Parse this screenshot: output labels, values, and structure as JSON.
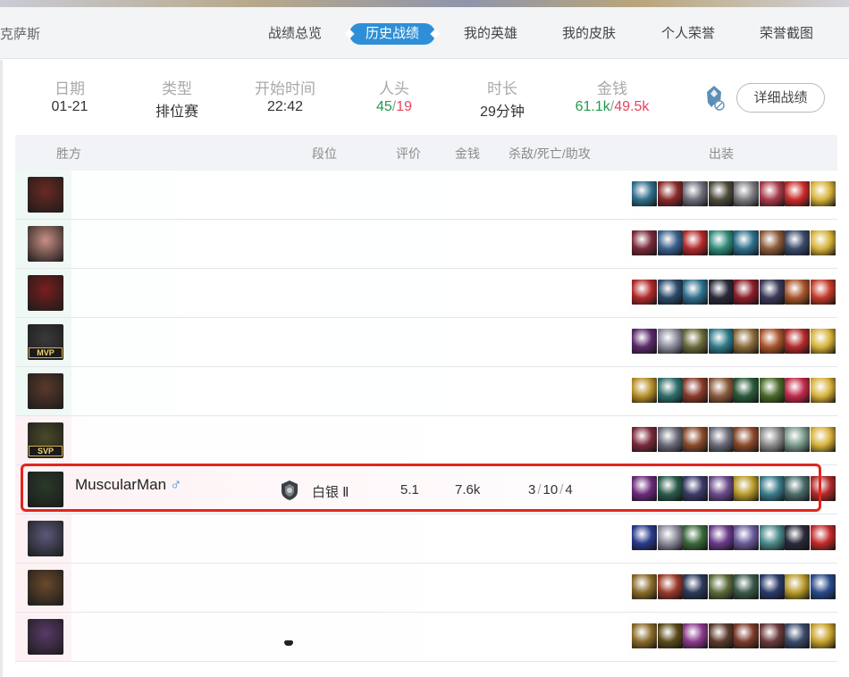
{
  "nav": {
    "player_name": "克萨斯",
    "tabs": [
      "战绩总览",
      "历史战绩",
      "我的英雄",
      "我的皮肤",
      "个人荣誉",
      "荣誉截图"
    ],
    "active_tab": "历史战绩"
  },
  "summary": {
    "date_label": "日期",
    "date": "01-21",
    "type_label": "类型",
    "type": "排位赛",
    "start_label": "开始时间",
    "start": "22:42",
    "kills_label": "人头",
    "kills_win": "45",
    "kills_sep": "/",
    "kills_loss": "19",
    "duration_label": "时长",
    "duration": "29分钟",
    "gold_label": "金钱",
    "gold_win": "61.1k",
    "gold_sep": "/",
    "gold_loss": "49.5k",
    "detail_button": "详细战绩"
  },
  "table": {
    "headers": {
      "team": "胜方",
      "rank": "段位",
      "score": "评价",
      "gold": "金钱",
      "kda": "杀敌/死亡/助攻",
      "build": "出装"
    }
  },
  "players": [
    {
      "champ_color": "#6b2a22",
      "badge": "",
      "items": [
        "#2f6f8c",
        "#8a2a2a",
        "#6b6e7a",
        "#4d4a3a",
        "#7a7a80",
        "#a83a4a",
        "#c82a2a",
        "#d7b23a"
      ]
    },
    {
      "champ_color": "#c98f84",
      "badge": "",
      "items": [
        "#7a2a3a",
        "#3a5f8a",
        "#b22a2a",
        "#2f8a7a",
        "#2f6f8c",
        "#8a5a3a",
        "#3a4a6a",
        "#d7b23a"
      ]
    },
    {
      "champ_color": "#7a1e1e",
      "badge": "",
      "items": [
        "#b22a2a",
        "#2a4a6a",
        "#2f6f8c",
        "#2a2a3a",
        "#8a1e2a",
        "#3a3a5a",
        "#a8542a",
        "#c23a2a"
      ]
    },
    {
      "champ_color": "#3a3a3a",
      "badge": "MVP",
      "items": [
        "#5a2a6a",
        "#8a8a9a",
        "#6a6a3a",
        "#2f7a8a",
        "#8a6a3a",
        "#a8542a",
        "#b22a2a",
        "#d7b23a"
      ]
    },
    {
      "champ_color": "#5a3a2a",
      "badge": "",
      "items": [
        "#b8902a",
        "#2f6f6a",
        "#8a3a2a",
        "#8a5a3a",
        "#2a5a3a",
        "#4a6a2a",
        "#c22a4a",
        "#d7b23a"
      ]
    },
    {
      "champ_color": "#4a4a2a",
      "badge": "SVP",
      "items": [
        "#7a2a3a",
        "#6a6a7a",
        "#8a4a2a",
        "#6a6a7a",
        "#8a4a2a",
        "#8a8a8a",
        "#7a9a8a",
        "#d7b23a"
      ]
    },
    {
      "champ_color": "#2a3a2a",
      "badge": "",
      "name": "MuscularMan",
      "gender": "♂",
      "rank": "白银 Ⅱ",
      "score": "5.1",
      "gold": "7.6k",
      "kills": "3",
      "deaths": "10",
      "assists": "4",
      "items": [
        "#6a2a7a",
        "#2a5a4a",
        "#3a3a6a",
        "#6a4a8a",
        "#b89a2a",
        "#3a7a8a",
        "#4a6a6a",
        "#b22a2a"
      ]
    },
    {
      "champ_color": "#5a5a7a",
      "badge": "",
      "items": [
        "#2a3a8a",
        "#8a8a9a",
        "#3a6a3a",
        "#6a3a8a",
        "#6a5a9a",
        "#4a8a8a",
        "#2a2a3a",
        "#c22a2a"
      ]
    },
    {
      "champ_color": "#6a4a2a",
      "badge": "",
      "items": [
        "#8a6a2a",
        "#9a3a2a",
        "#2a3a5a",
        "#5a6a3a",
        "#3a5a4a",
        "#2a3a6a",
        "#b89a2a",
        "#2a4a8a"
      ]
    },
    {
      "champ_color": "#5a3a6a",
      "badge": "",
      "items": [
        "#8a6a2a",
        "#5a4a1a",
        "#8a3a8a",
        "#5a3a2a",
        "#7a3a2a",
        "#6a3a3a",
        "#3a4a6a",
        "#c8a22a"
      ]
    }
  ],
  "colors": {
    "accent": "#2e8fd8",
    "win": "#1f9a4e",
    "loss": "#e5455d",
    "highlight": "#e0261f"
  }
}
